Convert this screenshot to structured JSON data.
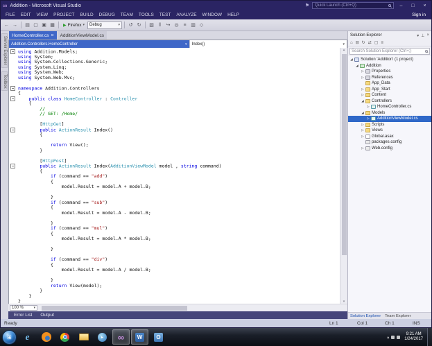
{
  "window": {
    "title": "Addition - Microsoft Visual Studio",
    "quick_launch_placeholder": "Quick Launch (Ctrl+Q)",
    "sign_in_label": "Sign in"
  },
  "menu_bar": [
    "FILE",
    "EDIT",
    "VIEW",
    "PROJECT",
    "BUILD",
    "DEBUG",
    "TEAM",
    "TOOLS",
    "TEST",
    "ANALYZE",
    "WINDOW",
    "HELP"
  ],
  "toolbar": {
    "nav_icons": [
      "back",
      "forward"
    ],
    "file_icons": [
      "new-project",
      "open-file",
      "save",
      "save-all"
    ],
    "run_label": "Firefox",
    "config_label": "Debug",
    "edit_icons": [
      "undo",
      "redo"
    ],
    "right_icons": [
      "build",
      "break-all",
      "step-over",
      "find",
      "solution-explorer-tool",
      "properties-tool",
      "extensions"
    ]
  },
  "tabs": [
    {
      "label": "HomeController.cs",
      "active": true
    },
    {
      "label": "AdditionViewModel.cs",
      "active": false
    }
  ],
  "navbar": {
    "type_path": "Addition.Controllers.HomeController",
    "member": "Index()"
  },
  "editor": {
    "zoom_label": "100 %",
    "lines": [
      {
        "f": 1,
        "s": [
          [
            "k",
            "using"
          ],
          [
            "p",
            " Addition.Models;"
          ]
        ]
      },
      {
        "f": 0,
        "s": [
          [
            "k",
            "using"
          ],
          [
            "p",
            " System;"
          ]
        ]
      },
      {
        "f": 0,
        "s": [
          [
            "k",
            "using"
          ],
          [
            "p",
            " System.Collections.Generic;"
          ]
        ]
      },
      {
        "f": 0,
        "s": [
          [
            "k",
            "using"
          ],
          [
            "p",
            " System.Linq;"
          ]
        ]
      },
      {
        "f": 0,
        "s": [
          [
            "k",
            "using"
          ],
          [
            "p",
            " System.Web;"
          ]
        ]
      },
      {
        "f": 0,
        "s": [
          [
            "k",
            "using"
          ],
          [
            "p",
            " System.Web.Mvc;"
          ]
        ]
      },
      {
        "f": 0,
        "s": []
      },
      {
        "f": 1,
        "s": [
          [
            "k",
            "namespace"
          ],
          [
            "p",
            " Addition.Controllers"
          ]
        ]
      },
      {
        "f": 0,
        "s": [
          [
            "p",
            "{"
          ]
        ]
      },
      {
        "f": 1,
        "s": [
          [
            "p",
            "    "
          ],
          [
            "k",
            "public"
          ],
          [
            "p",
            " "
          ],
          [
            "k",
            "class"
          ],
          [
            "p",
            " "
          ],
          [
            "t",
            "HomeController"
          ],
          [
            "p",
            " : "
          ],
          [
            "t",
            "Controller"
          ]
        ]
      },
      {
        "f": 0,
        "s": [
          [
            "p",
            "    {"
          ]
        ]
      },
      {
        "f": 0,
        "s": [
          [
            "c",
            "        //"
          ]
        ]
      },
      {
        "f": 0,
        "s": [
          [
            "c",
            "        // GET: /Home/"
          ]
        ]
      },
      {
        "f": 0,
        "s": []
      },
      {
        "f": 0,
        "s": [
          [
            "p",
            "        ["
          ],
          [
            "t",
            "HttpGet"
          ],
          [
            "p",
            "]"
          ]
        ]
      },
      {
        "f": 1,
        "s": [
          [
            "p",
            "        "
          ],
          [
            "k",
            "public"
          ],
          [
            "p",
            " "
          ],
          [
            "t",
            "ActionResult"
          ],
          [
            "p",
            " Index()"
          ]
        ]
      },
      {
        "f": 0,
        "s": [
          [
            "p",
            "        {"
          ]
        ]
      },
      {
        "f": 0,
        "s": []
      },
      {
        "f": 0,
        "s": [
          [
            "p",
            "            "
          ],
          [
            "k",
            "return"
          ],
          [
            "p",
            " View();"
          ]
        ]
      },
      {
        "f": 0,
        "s": [
          [
            "p",
            "        }"
          ]
        ]
      },
      {
        "f": 0,
        "s": []
      },
      {
        "f": 0,
        "s": [
          [
            "p",
            "        ["
          ],
          [
            "t",
            "HttpPost"
          ],
          [
            "p",
            "]"
          ]
        ]
      },
      {
        "f": 1,
        "s": [
          [
            "p",
            "        "
          ],
          [
            "k",
            "public"
          ],
          [
            "p",
            " "
          ],
          [
            "t",
            "ActionResult"
          ],
          [
            "p",
            " Index("
          ],
          [
            "t",
            "AdditionViewModel"
          ],
          [
            "p",
            " model , "
          ],
          [
            "k",
            "string"
          ],
          [
            "p",
            " command)"
          ]
        ]
      },
      {
        "f": 0,
        "s": [
          [
            "p",
            "        {"
          ]
        ]
      },
      {
        "f": 0,
        "s": [
          [
            "p",
            "            "
          ],
          [
            "k",
            "if"
          ],
          [
            "p",
            " (command == "
          ],
          [
            "s",
            "\"add\""
          ],
          [
            "p",
            ")"
          ]
        ]
      },
      {
        "f": 0,
        "s": [
          [
            "p",
            "            {"
          ]
        ]
      },
      {
        "f": 0,
        "s": [
          [
            "p",
            "                model.Result = model.A + model.B;"
          ]
        ]
      },
      {
        "f": 0,
        "s": []
      },
      {
        "f": 0,
        "s": [
          [
            "p",
            "            }"
          ]
        ]
      },
      {
        "f": 0,
        "s": [
          [
            "p",
            "            "
          ],
          [
            "k",
            "if"
          ],
          [
            "p",
            " (command == "
          ],
          [
            "s",
            "\"sub\""
          ],
          [
            "p",
            ")"
          ]
        ]
      },
      {
        "f": 0,
        "s": [
          [
            "p",
            "            {"
          ]
        ]
      },
      {
        "f": 0,
        "s": [
          [
            "p",
            "                model.Result = model.A - model.B;"
          ]
        ]
      },
      {
        "f": 0,
        "s": []
      },
      {
        "f": 0,
        "s": [
          [
            "p",
            "            }"
          ]
        ]
      },
      {
        "f": 0,
        "s": [
          [
            "p",
            "            "
          ],
          [
            "k",
            "if"
          ],
          [
            "p",
            " (command == "
          ],
          [
            "s",
            "\"mul\""
          ],
          [
            "p",
            ")"
          ]
        ]
      },
      {
        "f": 0,
        "s": [
          [
            "p",
            "            {"
          ]
        ]
      },
      {
        "f": 0,
        "s": [
          [
            "p",
            "                model.Result = model.A * model.B;"
          ]
        ]
      },
      {
        "f": 0,
        "s": []
      },
      {
        "f": 0,
        "s": [
          [
            "p",
            "            }"
          ]
        ]
      },
      {
        "f": 0,
        "s": []
      },
      {
        "f": 0,
        "s": [
          [
            "p",
            "            "
          ],
          [
            "k",
            "if"
          ],
          [
            "p",
            " (command == "
          ],
          [
            "s",
            "\"div\""
          ],
          [
            "p",
            ")"
          ]
        ]
      },
      {
        "f": 0,
        "s": [
          [
            "p",
            "            {"
          ]
        ]
      },
      {
        "f": 0,
        "s": [
          [
            "p",
            "                model.Result = model.A / model.B;"
          ]
        ]
      },
      {
        "f": 0,
        "s": []
      },
      {
        "f": 0,
        "s": [
          [
            "p",
            "            }"
          ]
        ]
      },
      {
        "f": 0,
        "s": [
          [
            "p",
            "            "
          ],
          [
            "k",
            "return"
          ],
          [
            "p",
            " View(model);"
          ]
        ]
      },
      {
        "f": 0,
        "s": [
          [
            "p",
            "        }"
          ]
        ]
      },
      {
        "f": 0,
        "s": [
          [
            "p",
            "    }"
          ]
        ]
      },
      {
        "f": 0,
        "s": [
          [
            "p",
            "}"
          ]
        ]
      }
    ]
  },
  "left_tabs": [
    "Server Explorer",
    "Toolbox"
  ],
  "bottom_tabs": [
    "Error List",
    "Output"
  ],
  "solution_explorer": {
    "title": "Solution Explorer",
    "header_icons": [
      "chevron",
      "pin",
      "close"
    ],
    "toolbar_icons": [
      "home",
      "collapse-all",
      "refresh",
      "sync",
      "preview",
      "pending"
    ],
    "search_placeholder": "Search Solution Explorer (Ctrl+;)",
    "tree": [
      {
        "label": "Solution 'Addition' (1 project)",
        "level": 0,
        "icon": "solution",
        "expand": "expanded"
      },
      {
        "label": "Addition",
        "level": 1,
        "icon": "project",
        "expand": "expanded"
      },
      {
        "label": "Properties",
        "level": 2,
        "icon": "properties",
        "expand": "collapsed"
      },
      {
        "label": "References",
        "level": 2,
        "icon": "references",
        "expand": "collapsed"
      },
      {
        "label": "App_Data",
        "level": 2,
        "icon": "folder",
        "expand": "none"
      },
      {
        "label": "App_Start",
        "level": 2,
        "icon": "folder",
        "expand": "collapsed"
      },
      {
        "label": "Content",
        "level": 2,
        "icon": "folder",
        "expand": "collapsed"
      },
      {
        "label": "Controllers",
        "level": 2,
        "icon": "folder",
        "expand": "expanded"
      },
      {
        "label": "HomeController.cs",
        "level": 3,
        "icon": "cs",
        "expand": "collapsed"
      },
      {
        "label": "Models",
        "level": 2,
        "icon": "folder",
        "expand": "expanded"
      },
      {
        "label": "AdditionViewModel.cs",
        "level": 3,
        "icon": "cs",
        "expand": "collapsed",
        "selected": true
      },
      {
        "label": "Scripts",
        "level": 2,
        "icon": "folder",
        "expand": "collapsed"
      },
      {
        "label": "Views",
        "level": 2,
        "icon": "folder",
        "expand": "collapsed"
      },
      {
        "label": "Global.asax",
        "level": 2,
        "icon": "asax",
        "expand": "collapsed"
      },
      {
        "label": "packages.config",
        "level": 2,
        "icon": "config",
        "expand": "none"
      },
      {
        "label": "Web.config",
        "level": 2,
        "icon": "config",
        "expand": "collapsed"
      }
    ],
    "bottom_tabs": [
      "Solution Explorer",
      "Team Explorer"
    ]
  },
  "status_bar": {
    "message": "Ready",
    "position": [
      "Ln 1",
      "Col 1",
      "Ch 1",
      "INS"
    ]
  },
  "taskbar": {
    "apps": [
      {
        "name": "internet-explorer",
        "glyph": "e"
      },
      {
        "name": "firefox",
        "glyph": ""
      },
      {
        "name": "chrome",
        "glyph": ""
      },
      {
        "name": "file-explorer",
        "glyph": ""
      },
      {
        "name": "media-player",
        "glyph": "▸"
      },
      {
        "name": "visual-studio",
        "glyph": "∞",
        "active": true
      },
      {
        "name": "word",
        "glyph": "W",
        "active": true
      },
      {
        "name": "outlook",
        "glyph": "O"
      }
    ],
    "clock_time": "9:21 AM",
    "clock_date": "1/24/2017"
  },
  "glyphs": {
    "back": "←",
    "forward": "→",
    "new-project": "▤",
    "open-file": "▢",
    "save": "▣",
    "save-all": "▦",
    "undo": "↺",
    "redo": "↻",
    "build": "▧",
    "break-all": "‖",
    "step-over": "↪",
    "find": "◎",
    "solution-explorer-tool": "≡",
    "properties-tool": "▥",
    "extensions": "◇",
    "home": "⌂",
    "collapse-all": "⊟",
    "refresh": "↻",
    "sync": "⇄",
    "preview": "▢",
    "pending": "≡",
    "chevron": "▾",
    "pin": "⊥",
    "close": "×",
    "minimize": "–",
    "maximize": "□",
    "play": "▶",
    "collapsed": "▷",
    "expanded": "◢",
    "tray-up": "▴",
    "flag": "⚑",
    "vs-logo": "∞",
    "start": "⊞"
  },
  "colors": {
    "titlebar": "#2a2463",
    "accent_tab": "#3f67c8",
    "selection": "#2f68c8",
    "keyword": "#0000e0",
    "type": "#2b91af",
    "comment": "#008000",
    "string": "#a31515"
  }
}
